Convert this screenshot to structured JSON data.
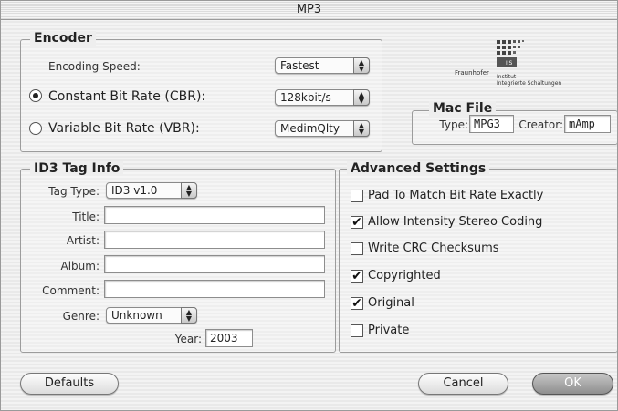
{
  "window": {
    "title": "MP3"
  },
  "encoder": {
    "legend": "Encoder",
    "speed_label": "Encoding Speed:",
    "speed_value": "Fastest",
    "cbr_label": "Constant Bit Rate (CBR):",
    "cbr_value": "128kbit/s",
    "cbr_selected": true,
    "vbr_label": "Variable Bit Rate (VBR):",
    "vbr_value": "MedimQlty",
    "vbr_selected": false
  },
  "logo": {
    "org": "Fraunhofer",
    "line1": "Institut",
    "line2": "Integrierte Schaltungen",
    "mark": "IIS"
  },
  "mac_file": {
    "legend": "Mac File",
    "type_label": "Type:",
    "type_value": "MPG3",
    "creator_label": "Creator:",
    "creator_value": "mAmp"
  },
  "id3": {
    "legend": "ID3 Tag Info",
    "tag_type_label": "Tag Type:",
    "tag_type_value": "ID3 v1.0",
    "title_label": "Title:",
    "title_value": "",
    "artist_label": "Artist:",
    "artist_value": "",
    "album_label": "Album:",
    "album_value": "",
    "comment_label": "Comment:",
    "comment_value": "",
    "genre_label": "Genre:",
    "genre_value": "Unknown",
    "year_label": "Year:",
    "year_value": "2003"
  },
  "advanced": {
    "legend": "Advanced Settings",
    "options": [
      {
        "label": "Pad To Match Bit Rate Exactly",
        "checked": false
      },
      {
        "label": "Allow Intensity Stereo Coding",
        "checked": true
      },
      {
        "label": "Write CRC Checksums",
        "checked": false
      },
      {
        "label": "Copyrighted",
        "checked": true
      },
      {
        "label": "Original",
        "checked": true
      },
      {
        "label": "Private",
        "checked": false
      }
    ]
  },
  "buttons": {
    "defaults": "Defaults",
    "cancel": "Cancel",
    "ok": "OK"
  }
}
